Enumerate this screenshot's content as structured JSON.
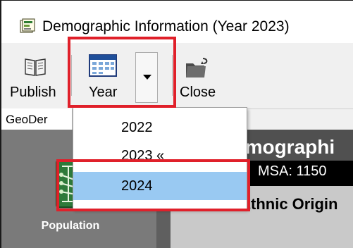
{
  "window": {
    "title": "Demographic Information (Year 2023)"
  },
  "toolbar": {
    "publish_label": "Publish",
    "year_label": "Year",
    "close_label": "Close"
  },
  "tabs": [
    {
      "label": "GeoDer"
    }
  ],
  "year_menu": {
    "items": [
      {
        "label": "2022",
        "selected": false
      },
      {
        "label": "2023 «",
        "selected": false
      },
      {
        "label": "2024",
        "selected": true
      }
    ]
  },
  "report": {
    "banner": "emographi",
    "msa": "MSA: 1150",
    "race_heading": "Race or Ethnic Origin"
  },
  "sidebar": {
    "population_label": "Population"
  },
  "colors": {
    "highlight": "#e0202a",
    "selected_item": "#99c9f2"
  }
}
